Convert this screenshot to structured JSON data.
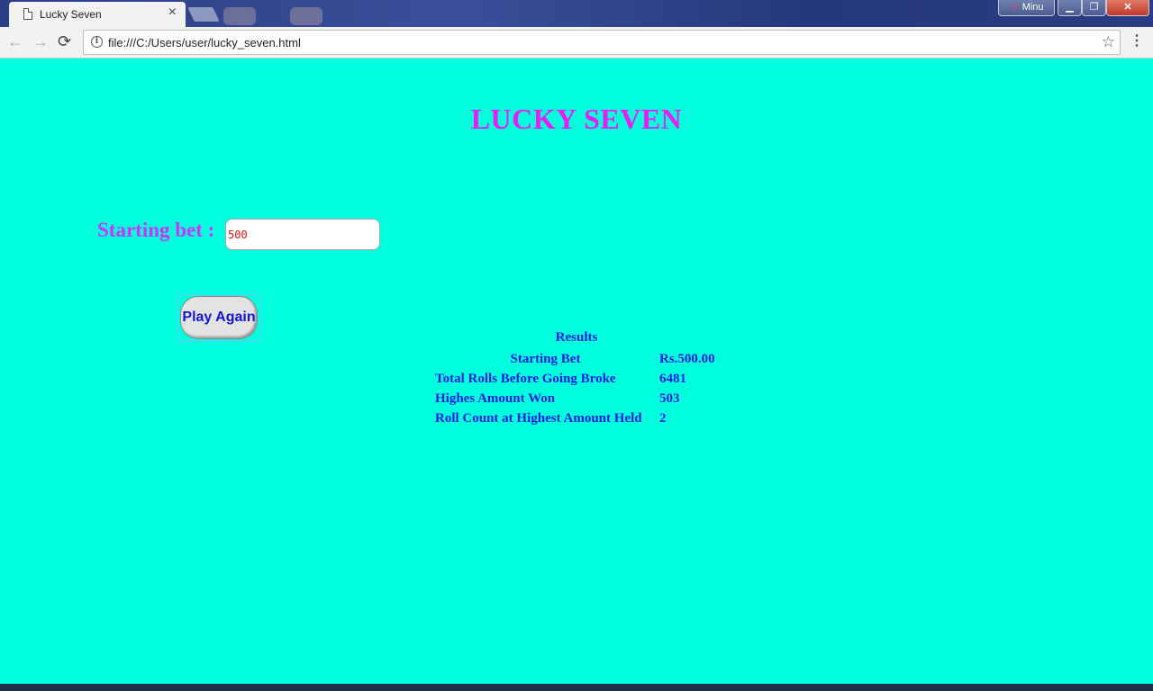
{
  "browser": {
    "tab_title": "Lucky Seven",
    "tab_close": "×",
    "url": "file:///C:/Users/user/lucky_seven.html",
    "user_label": "Minu",
    "colors": {
      "titlebar": "#2c3f86",
      "toolbar": "#f2f2f2"
    }
  },
  "page": {
    "background": "#00ffdd",
    "title": "LUCKY SEVEN",
    "title_color": "#ee1bf2"
  },
  "form": {
    "starting_bet_label": "Starting bet :",
    "starting_bet_value": "500",
    "play_button": "Play Again"
  },
  "results": {
    "heading": "Results",
    "rows": [
      {
        "label": "Starting Bet",
        "value": "Rs.500.00"
      },
      {
        "label": "Total Rolls Before Going Broke",
        "value": "6481"
      },
      {
        "label": "Highes Amount Won",
        "value": "503"
      },
      {
        "label": "Roll Count at Highest Amount Held",
        "value": "2"
      }
    ],
    "text_color": "#1a1ae6"
  }
}
